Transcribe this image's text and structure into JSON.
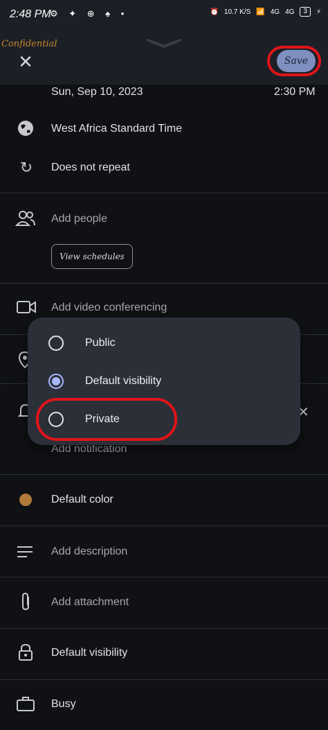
{
  "status_bar": {
    "time": "2:48 PM",
    "left_icons": [
      "settings-icon",
      "chat-icon",
      "plus-circle-icon",
      "bell-icon",
      "dot-icon"
    ],
    "speed": "10.7 K/S",
    "network_1": "4G",
    "network_2": "4G",
    "battery": "3"
  },
  "header": {
    "watermark": "Confidential",
    "close_icon": "close-icon",
    "save_label": "Save"
  },
  "event": {
    "date": "Sun, Sep 10, 2023",
    "time": "2:30 PM",
    "timezone": "West Africa Standard Time",
    "repeat": "Does not repeat",
    "people": "Add people",
    "view_schedules": "View schedules",
    "video": "Add video conferencing",
    "notification": "Add notification",
    "color": "Default color",
    "color_hex": "#b07a3b",
    "description": "Add description",
    "attachment": "Add attachment",
    "visibility": "Default visibility",
    "busy": "Busy"
  },
  "visibility_menu": {
    "options": [
      {
        "label": "Public",
        "selected": false
      },
      {
        "label": "Default visibility",
        "selected": true
      },
      {
        "label": "Private",
        "selected": false
      }
    ]
  }
}
